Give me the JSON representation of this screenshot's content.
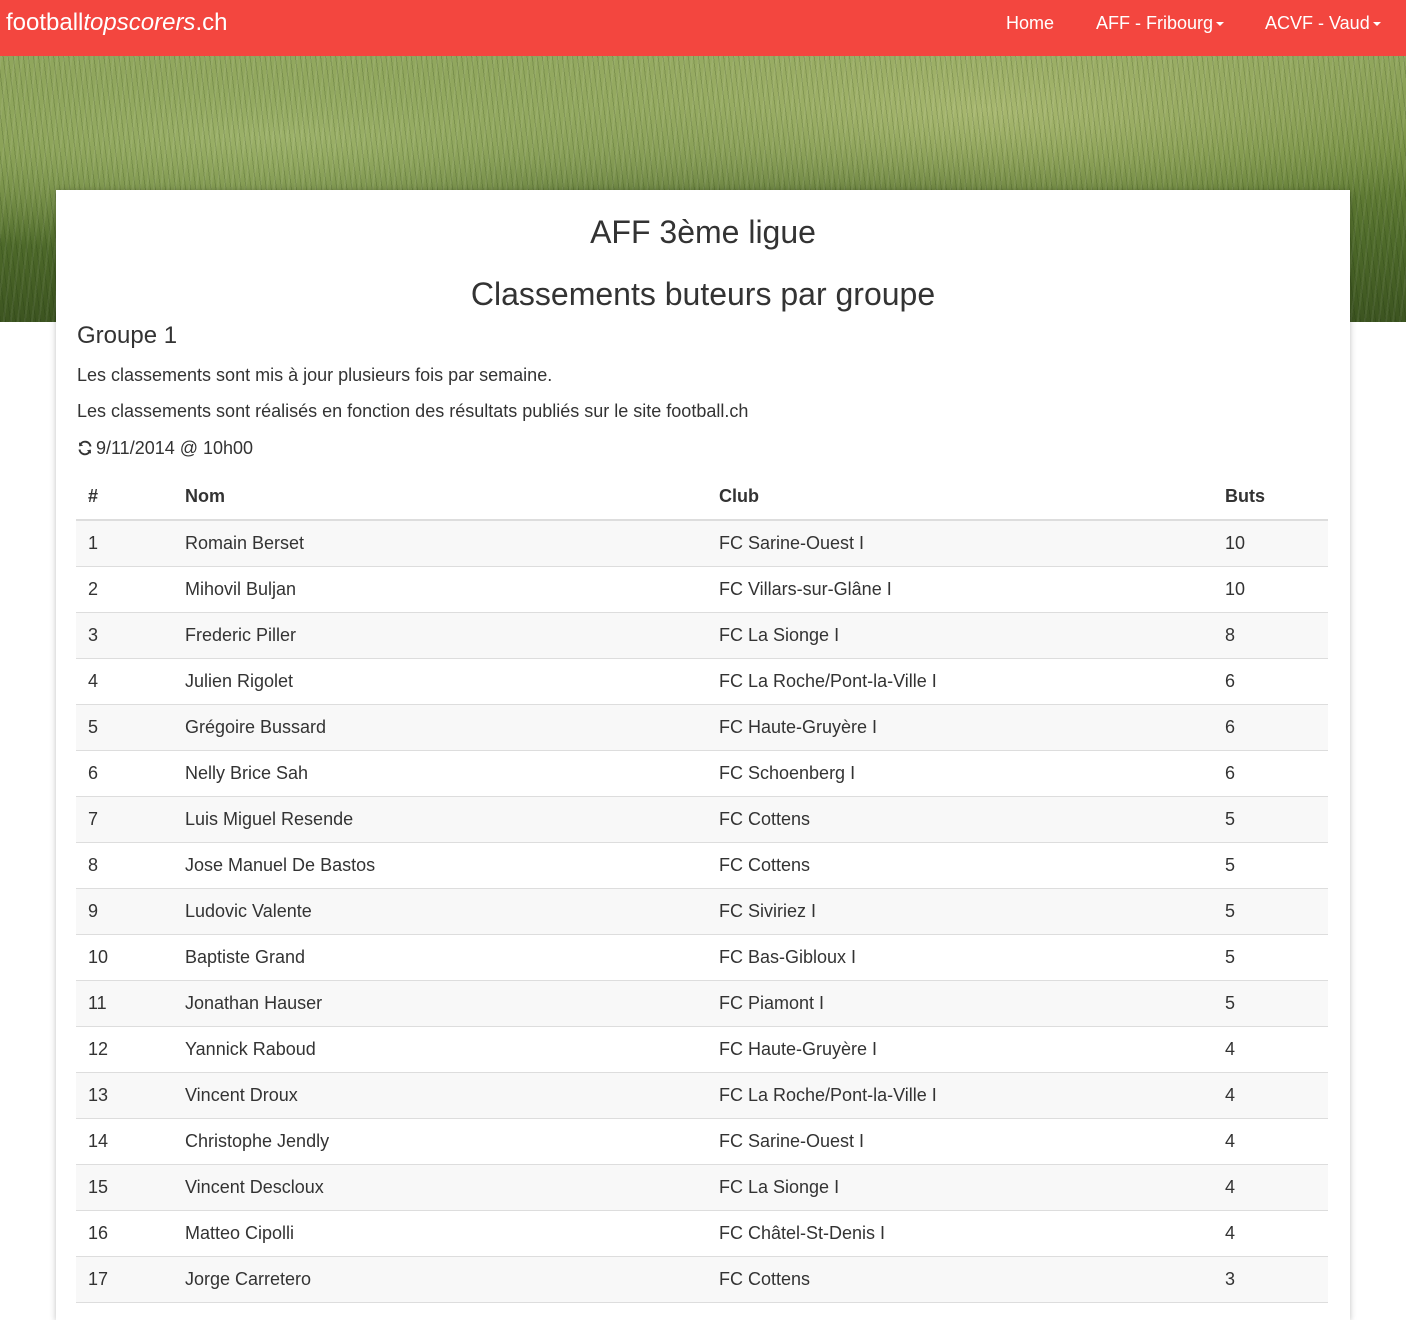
{
  "navbar": {
    "brand_plain": "football",
    "brand_italic": "topscorers",
    "brand_suffix": ".ch",
    "home": "Home",
    "aff": "AFF - Fribourg",
    "acvf": "ACVF - Vaud"
  },
  "page": {
    "league": "AFF 3ème ligue",
    "title": "Classements buteurs par groupe",
    "group": "Groupe 1",
    "info1": "Les classements sont mis à jour plusieurs fois par semaine.",
    "info2": "Les classements sont réalisés en fonction des résultats publiés sur le site football.ch",
    "updated": "9/11/2014 @ 10h00",
    "refresh_icon": "refresh-icon"
  },
  "table": {
    "headers": [
      "#",
      "Nom",
      "Club",
      "Buts"
    ],
    "rows": [
      {
        "rank": "1",
        "name": "Romain Berset",
        "club": "FC Sarine-Ouest I",
        "goals": "10"
      },
      {
        "rank": "2",
        "name": "Mihovil Buljan",
        "club": "FC Villars-sur-Glâne I",
        "goals": "10"
      },
      {
        "rank": "3",
        "name": "Frederic Piller",
        "club": "FC La Sionge I",
        "goals": "8"
      },
      {
        "rank": "4",
        "name": "Julien Rigolet",
        "club": "FC La Roche/Pont-la-Ville I",
        "goals": "6"
      },
      {
        "rank": "5",
        "name": "Grégoire Bussard",
        "club": "FC Haute-Gruyère I",
        "goals": "6"
      },
      {
        "rank": "6",
        "name": "Nelly Brice Sah",
        "club": "FC Schoenberg I",
        "goals": "6"
      },
      {
        "rank": "7",
        "name": "Luis Miguel Resende",
        "club": "FC Cottens",
        "goals": "5"
      },
      {
        "rank": "8",
        "name": "Jose Manuel De Bastos",
        "club": "FC Cottens",
        "goals": "5"
      },
      {
        "rank": "9",
        "name": "Ludovic Valente",
        "club": "FC Siviriez I",
        "goals": "5"
      },
      {
        "rank": "10",
        "name": "Baptiste Grand",
        "club": "FC Bas-Gibloux I",
        "goals": "5"
      },
      {
        "rank": "11",
        "name": "Jonathan Hauser",
        "club": "FC Piamont I",
        "goals": "5"
      },
      {
        "rank": "12",
        "name": "Yannick Raboud",
        "club": "FC Haute-Gruyère I",
        "goals": "4"
      },
      {
        "rank": "13",
        "name": "Vincent Droux",
        "club": "FC La Roche/Pont-la-Ville I",
        "goals": "4"
      },
      {
        "rank": "14",
        "name": "Christophe Jendly",
        "club": "FC Sarine-Ouest I",
        "goals": "4"
      },
      {
        "rank": "15",
        "name": "Vincent Descloux",
        "club": "FC La Sionge I",
        "goals": "4"
      },
      {
        "rank": "16",
        "name": "Matteo Cipolli",
        "club": "FC Châtel-St-Denis I",
        "goals": "4"
      },
      {
        "rank": "17",
        "name": "Jorge Carretero",
        "club": "FC Cottens",
        "goals": "3"
      }
    ]
  },
  "colors": {
    "navbar": "#f3463f",
    "text": "#333333",
    "stripe": "#f8f8f8",
    "border": "#dddddd"
  }
}
